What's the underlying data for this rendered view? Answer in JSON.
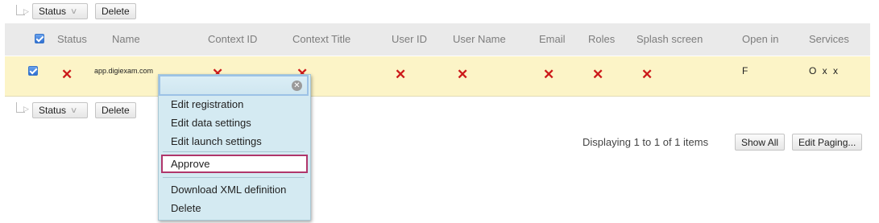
{
  "top_toolbar": {
    "status_label": "Status",
    "delete_label": "Delete"
  },
  "bottom_toolbar": {
    "status_label": "Status",
    "delete_label": "Delete"
  },
  "table": {
    "headers": [
      "Status",
      "Name",
      "Context ID",
      "Context Title",
      "User ID",
      "User Name",
      "Email",
      "Roles",
      "Splash screen",
      "Open in",
      "Services"
    ],
    "row": {
      "name": "app.digiexam.com",
      "open_in": "F",
      "services": "O x x"
    }
  },
  "context_menu": {
    "items": [
      "Edit registration",
      "Edit data settings",
      "Edit launch settings",
      "Approve",
      "Download XML definition",
      "Delete"
    ],
    "highlighted_item": "Approve"
  },
  "paging": {
    "text": "Displaying 1 to 1 of 1 items",
    "show_all_label": "Show All",
    "edit_paging_label": "Edit Paging..."
  },
  "colors": {
    "header_bg": "#eaeaea",
    "row_selected_bg": "#fcf4c7",
    "error_x": "#cc1a1a",
    "menu_bg": "#d4eaf2",
    "highlight_border": "#b0366b"
  }
}
